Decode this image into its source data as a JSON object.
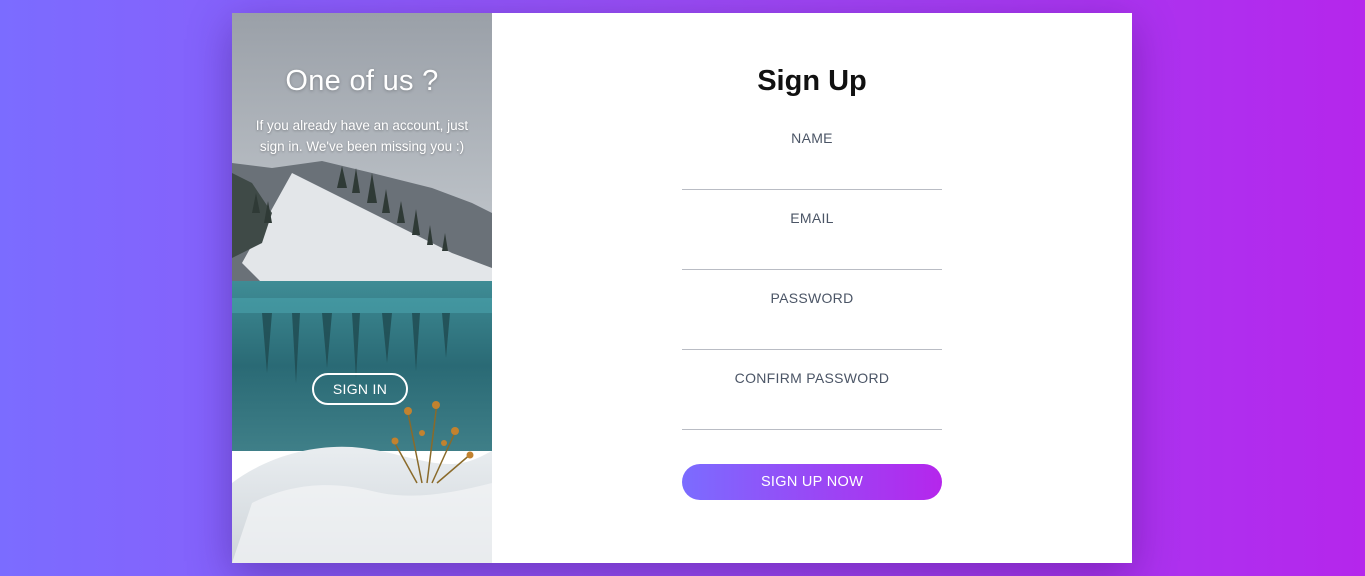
{
  "side": {
    "title": "One of us ?",
    "text": "If you already have an account, just sign in. We've been missing you :)",
    "signin_label": "SIGN IN"
  },
  "form": {
    "title": "Sign Up",
    "fields": [
      {
        "label": "NAME",
        "value": ""
      },
      {
        "label": "EMAIL",
        "value": ""
      },
      {
        "label": "PASSWORD",
        "value": ""
      },
      {
        "label": "CONFIRM PASSWORD",
        "value": ""
      }
    ],
    "submit_label": "SIGN UP NOW"
  },
  "colors": {
    "gradient_start": "#7b6cff",
    "gradient_end": "#b526ec",
    "card_background": "#ffffff",
    "label_text": "#4b5566"
  },
  "image": "mountain-lake-winter-photo"
}
